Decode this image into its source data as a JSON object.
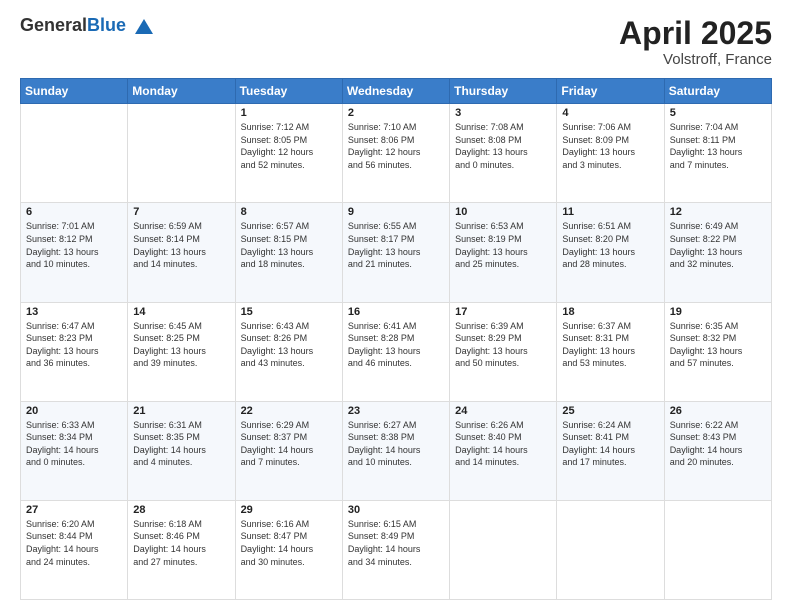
{
  "header": {
    "logo_general": "General",
    "logo_blue": "Blue",
    "month_title": "April 2025",
    "location": "Volstroff, France"
  },
  "weekdays": [
    "Sunday",
    "Monday",
    "Tuesday",
    "Wednesday",
    "Thursday",
    "Friday",
    "Saturday"
  ],
  "weeks": [
    [
      {
        "day": "",
        "info": ""
      },
      {
        "day": "",
        "info": ""
      },
      {
        "day": "1",
        "info": "Sunrise: 7:12 AM\nSunset: 8:05 PM\nDaylight: 12 hours\nand 52 minutes."
      },
      {
        "day": "2",
        "info": "Sunrise: 7:10 AM\nSunset: 8:06 PM\nDaylight: 12 hours\nand 56 minutes."
      },
      {
        "day": "3",
        "info": "Sunrise: 7:08 AM\nSunset: 8:08 PM\nDaylight: 13 hours\nand 0 minutes."
      },
      {
        "day": "4",
        "info": "Sunrise: 7:06 AM\nSunset: 8:09 PM\nDaylight: 13 hours\nand 3 minutes."
      },
      {
        "day": "5",
        "info": "Sunrise: 7:04 AM\nSunset: 8:11 PM\nDaylight: 13 hours\nand 7 minutes."
      }
    ],
    [
      {
        "day": "6",
        "info": "Sunrise: 7:01 AM\nSunset: 8:12 PM\nDaylight: 13 hours\nand 10 minutes."
      },
      {
        "day": "7",
        "info": "Sunrise: 6:59 AM\nSunset: 8:14 PM\nDaylight: 13 hours\nand 14 minutes."
      },
      {
        "day": "8",
        "info": "Sunrise: 6:57 AM\nSunset: 8:15 PM\nDaylight: 13 hours\nand 18 minutes."
      },
      {
        "day": "9",
        "info": "Sunrise: 6:55 AM\nSunset: 8:17 PM\nDaylight: 13 hours\nand 21 minutes."
      },
      {
        "day": "10",
        "info": "Sunrise: 6:53 AM\nSunset: 8:19 PM\nDaylight: 13 hours\nand 25 minutes."
      },
      {
        "day": "11",
        "info": "Sunrise: 6:51 AM\nSunset: 8:20 PM\nDaylight: 13 hours\nand 28 minutes."
      },
      {
        "day": "12",
        "info": "Sunrise: 6:49 AM\nSunset: 8:22 PM\nDaylight: 13 hours\nand 32 minutes."
      }
    ],
    [
      {
        "day": "13",
        "info": "Sunrise: 6:47 AM\nSunset: 8:23 PM\nDaylight: 13 hours\nand 36 minutes."
      },
      {
        "day": "14",
        "info": "Sunrise: 6:45 AM\nSunset: 8:25 PM\nDaylight: 13 hours\nand 39 minutes."
      },
      {
        "day": "15",
        "info": "Sunrise: 6:43 AM\nSunset: 8:26 PM\nDaylight: 13 hours\nand 43 minutes."
      },
      {
        "day": "16",
        "info": "Sunrise: 6:41 AM\nSunset: 8:28 PM\nDaylight: 13 hours\nand 46 minutes."
      },
      {
        "day": "17",
        "info": "Sunrise: 6:39 AM\nSunset: 8:29 PM\nDaylight: 13 hours\nand 50 minutes."
      },
      {
        "day": "18",
        "info": "Sunrise: 6:37 AM\nSunset: 8:31 PM\nDaylight: 13 hours\nand 53 minutes."
      },
      {
        "day": "19",
        "info": "Sunrise: 6:35 AM\nSunset: 8:32 PM\nDaylight: 13 hours\nand 57 minutes."
      }
    ],
    [
      {
        "day": "20",
        "info": "Sunrise: 6:33 AM\nSunset: 8:34 PM\nDaylight: 14 hours\nand 0 minutes."
      },
      {
        "day": "21",
        "info": "Sunrise: 6:31 AM\nSunset: 8:35 PM\nDaylight: 14 hours\nand 4 minutes."
      },
      {
        "day": "22",
        "info": "Sunrise: 6:29 AM\nSunset: 8:37 PM\nDaylight: 14 hours\nand 7 minutes."
      },
      {
        "day": "23",
        "info": "Sunrise: 6:27 AM\nSunset: 8:38 PM\nDaylight: 14 hours\nand 10 minutes."
      },
      {
        "day": "24",
        "info": "Sunrise: 6:26 AM\nSunset: 8:40 PM\nDaylight: 14 hours\nand 14 minutes."
      },
      {
        "day": "25",
        "info": "Sunrise: 6:24 AM\nSunset: 8:41 PM\nDaylight: 14 hours\nand 17 minutes."
      },
      {
        "day": "26",
        "info": "Sunrise: 6:22 AM\nSunset: 8:43 PM\nDaylight: 14 hours\nand 20 minutes."
      }
    ],
    [
      {
        "day": "27",
        "info": "Sunrise: 6:20 AM\nSunset: 8:44 PM\nDaylight: 14 hours\nand 24 minutes."
      },
      {
        "day": "28",
        "info": "Sunrise: 6:18 AM\nSunset: 8:46 PM\nDaylight: 14 hours\nand 27 minutes."
      },
      {
        "day": "29",
        "info": "Sunrise: 6:16 AM\nSunset: 8:47 PM\nDaylight: 14 hours\nand 30 minutes."
      },
      {
        "day": "30",
        "info": "Sunrise: 6:15 AM\nSunset: 8:49 PM\nDaylight: 14 hours\nand 34 minutes."
      },
      {
        "day": "",
        "info": ""
      },
      {
        "day": "",
        "info": ""
      },
      {
        "day": "",
        "info": ""
      }
    ]
  ]
}
